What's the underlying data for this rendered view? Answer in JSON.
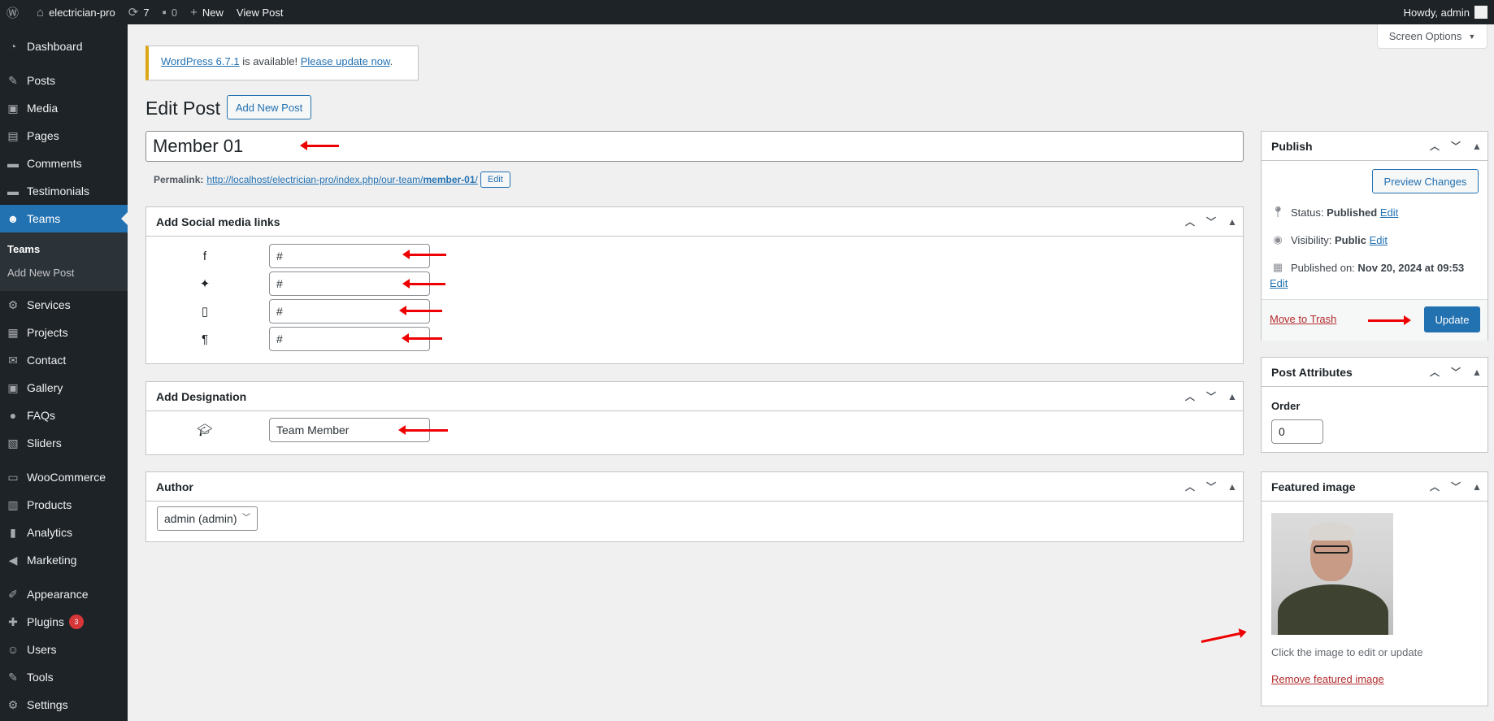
{
  "adminbar": {
    "site_name": "electrician-pro",
    "updates_count": "7",
    "comments_count": "0",
    "new_label": "New",
    "view_post_label": "View Post",
    "howdy": "Howdy, admin"
  },
  "sidebar": {
    "items": [
      {
        "label": "Dashboard",
        "icon": "dashboard-icon"
      },
      {
        "label": "Posts",
        "icon": "pin-icon"
      },
      {
        "label": "Media",
        "icon": "media-icon"
      },
      {
        "label": "Pages",
        "icon": "pages-icon"
      },
      {
        "label": "Comments",
        "icon": "comments-icon"
      },
      {
        "label": "Testimonials",
        "icon": "testimonials-icon"
      },
      {
        "label": "Teams",
        "icon": "groups-icon"
      },
      {
        "label": "Services",
        "icon": "services-icon"
      },
      {
        "label": "Projects",
        "icon": "projects-icon"
      },
      {
        "label": "Contact",
        "icon": "email-icon"
      },
      {
        "label": "Gallery",
        "icon": "gallery-icon"
      },
      {
        "label": "FAQs",
        "icon": "faq-icon"
      },
      {
        "label": "Sliders",
        "icon": "sliders-icon"
      },
      {
        "label": "WooCommerce",
        "icon": "woo-icon"
      },
      {
        "label": "Products",
        "icon": "products-icon"
      },
      {
        "label": "Analytics",
        "icon": "analytics-icon"
      },
      {
        "label": "Marketing",
        "icon": "marketing-icon"
      },
      {
        "label": "Appearance",
        "icon": "appearance-icon"
      },
      {
        "label": "Plugins",
        "icon": "plugins-icon",
        "badge": "3"
      },
      {
        "label": "Users",
        "icon": "users-icon"
      },
      {
        "label": "Tools",
        "icon": "tools-icon"
      },
      {
        "label": "Settings",
        "icon": "settings-icon"
      }
    ],
    "submenu": [
      "Teams",
      "Add New Post"
    ]
  },
  "screen_options": "Screen Options",
  "notice": {
    "version_link": "WordPress 6.7.1",
    "text": " is available! ",
    "update_link": "Please update now",
    "end": "."
  },
  "page": {
    "title": "Edit Post",
    "add_new": "Add New Post",
    "post_title": "Member 01",
    "permalink_label": "Permalink:",
    "permalink_base": "http://localhost/electrician-pro/index.php/our-team/",
    "permalink_slug": "member-01",
    "permalink_end": "/",
    "permalink_edit": "Edit"
  },
  "social_box": {
    "title": "Add Social media links",
    "rows": [
      {
        "icon": "facebook-icon",
        "value": "#"
      },
      {
        "icon": "twitter-icon",
        "value": "#"
      },
      {
        "icon": "phone-icon",
        "value": "#"
      },
      {
        "icon": "paragraph-icon",
        "value": "#"
      }
    ]
  },
  "designation_box": {
    "title": "Add Designation",
    "value": "Team Member"
  },
  "author_box": {
    "title": "Author",
    "selected": "admin (admin)"
  },
  "publish_box": {
    "title": "Publish",
    "preview": "Preview Changes",
    "status_label": "Status:",
    "status_value": "Published",
    "visibility_label": "Visibility:",
    "visibility_value": "Public",
    "published_label": "Published on:",
    "published_value": "Nov 20, 2024 at 09:53",
    "edit": "Edit",
    "trash": "Move to Trash",
    "update": "Update"
  },
  "attributes_box": {
    "title": "Post Attributes",
    "order_label": "Order",
    "order_value": "0"
  },
  "featured_box": {
    "title": "Featured image",
    "hint": "Click the image to edit or update",
    "remove": "Remove featured image"
  },
  "colors": {
    "accent": "#2271b1",
    "adminbar": "#1d2327",
    "annotation_arrow": "#e00000"
  }
}
